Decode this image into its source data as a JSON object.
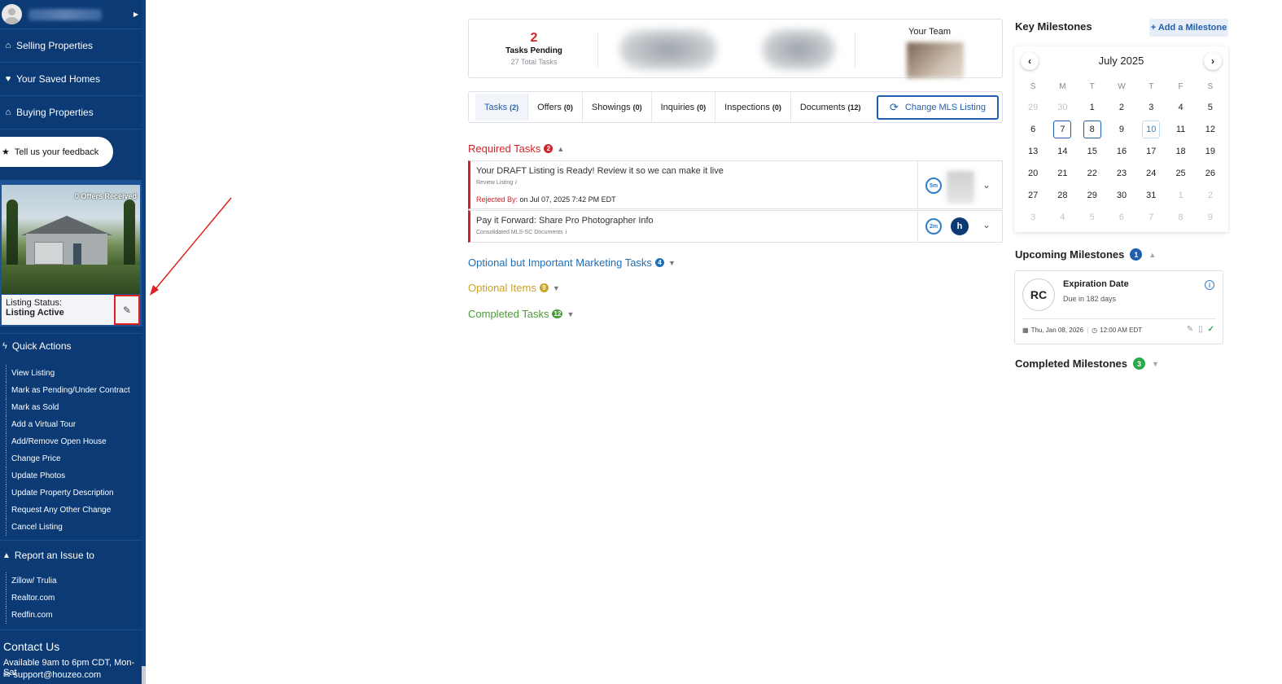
{
  "sidebar": {
    "nav": [
      {
        "label": "Selling Properties",
        "icon": "home-icon"
      },
      {
        "label": "Your Saved Homes",
        "icon": "heart-icon"
      },
      {
        "label": "Buying Properties",
        "icon": "home-icon"
      }
    ],
    "feedback_label": "Tell us your feedback",
    "listing": {
      "offers_badge": "0 Offers Received",
      "status_label": "Listing Status:",
      "status_value": "Listing Active"
    },
    "quick_actions_title": "Quick Actions",
    "quick_actions": [
      "View Listing",
      "Mark as Pending/Under Contract",
      "Mark as Sold",
      "Add a Virtual Tour",
      "Add/Remove Open House",
      "Change Price",
      "Update Photos",
      "Update Property Description",
      "Request Any Other Change",
      "Cancel Listing"
    ],
    "report_title": "Report an Issue to",
    "report_links": [
      "Zillow/ Trulia",
      "Realtor.com",
      "Redfin.com"
    ],
    "contact": {
      "title": "Contact Us",
      "hours": "Available 9am to 6pm CDT, Mon-Sat",
      "email": "support@houzeo.com"
    }
  },
  "summary": {
    "tasks_pending_count": "2",
    "tasks_pending_label": "Tasks Pending",
    "total_tasks": "27 Total Tasks",
    "team_label": "Your Team"
  },
  "tabs": [
    {
      "label": "Tasks",
      "count": "(2)"
    },
    {
      "label": "Offers",
      "count": "(0)"
    },
    {
      "label": "Showings",
      "count": "(0)"
    },
    {
      "label": "Inquiries",
      "count": "(0)"
    },
    {
      "label": "Inspections",
      "count": "(0)"
    },
    {
      "label": "Documents",
      "count": "(12)"
    }
  ],
  "change_mls_label": "Change MLS Listing",
  "sections": {
    "required": {
      "label": "Required Tasks",
      "count": "2"
    },
    "optional_marketing": {
      "label": "Optional but Important Marketing Tasks",
      "count": "4"
    },
    "optional_items": {
      "label": "Optional Items",
      "count": "9"
    },
    "completed": {
      "label": "Completed Tasks",
      "count": "12"
    }
  },
  "tasks": [
    {
      "title": "Your DRAFT Listing is Ready! Review it so we can make it live",
      "sub": "Review Listing",
      "rejected_by_label": "Rejected By:",
      "rejected_by_value": " on Jul 07, 2025 7:42 PM EDT",
      "timer": "5m"
    },
    {
      "title": "Pay it Forward: Share Pro Photographer Info",
      "sub": "Consolidated MLS-SC Documents",
      "timer": "2m"
    }
  ],
  "milestones": {
    "title": "Key Milestones",
    "add_label": "+ Add a Milestone",
    "calendar": {
      "month": "July 2025",
      "weekdays": [
        "S",
        "M",
        "T",
        "W",
        "T",
        "F",
        "S"
      ],
      "weeks": [
        [
          "29",
          "30",
          "1",
          "2",
          "3",
          "4",
          "5"
        ],
        [
          "6",
          "7",
          "8",
          "9",
          "10",
          "11",
          "12"
        ],
        [
          "13",
          "14",
          "15",
          "16",
          "17",
          "18",
          "19"
        ],
        [
          "20",
          "21",
          "22",
          "23",
          "24",
          "25",
          "26"
        ],
        [
          "27",
          "28",
          "29",
          "30",
          "31",
          "1",
          "2"
        ],
        [
          "3",
          "4",
          "5",
          "6",
          "7",
          "8",
          "9"
        ]
      ]
    },
    "upcoming_title": "Upcoming Milestones",
    "upcoming_count": "1",
    "upcoming": [
      {
        "initials": "RC",
        "title": "Expiration Date",
        "due": "Due in 182 days",
        "date": "Thu, Jan 08, 2026",
        "time": "12:00 AM EDT"
      }
    ],
    "completed_title": "Completed Milestones",
    "completed_count": "3"
  },
  "colors": {
    "sidebar": "#0b3a75",
    "accent": "#1f5fae",
    "required": "#d0242b",
    "optional": "#c9a227",
    "completed": "#4a9a3a",
    "annotation": "#e02020"
  }
}
